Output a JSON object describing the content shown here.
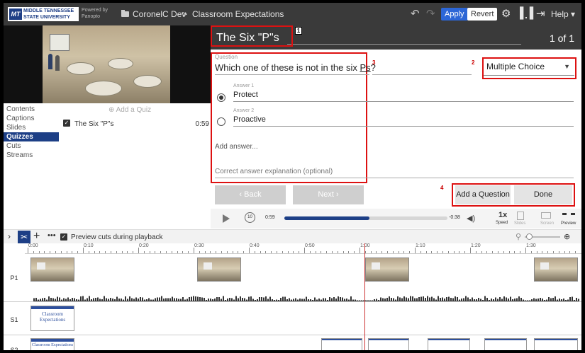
{
  "brand": {
    "line1": "MIDDLE TENNESSEE",
    "line2": "STATE UNIVERSITY",
    "mark": "MT",
    "powered_line1": "Powered by",
    "powered_line2": "Panopto"
  },
  "breadcrumb": {
    "folder": "CoronelC Dev",
    "separator": ">",
    "session": "Classroom Expectations"
  },
  "toolbar": {
    "undo": "↶",
    "redo": "↷",
    "apply": "Apply",
    "revert": "Revert",
    "settings_icon": "⚙",
    "stats_icon": "▐",
    "exit_icon": "⇥",
    "help": "Help ▾"
  },
  "nav": {
    "items": [
      "Contents",
      "Captions",
      "Slides",
      "Quizzes",
      "Cuts",
      "Streams"
    ],
    "active": "Quizzes"
  },
  "quizzes": {
    "add_label": "⊕ Add a Quiz",
    "rows": [
      {
        "title": "The Six \"P\"s",
        "time": "0:59"
      }
    ]
  },
  "quiz_editor": {
    "title": "The Six \"P\"s",
    "page": "1 of 1",
    "question_label": "Question",
    "question_prefix": "Which one of these is not in the six ",
    "question_underlined": "Ps",
    "question_suffix": "?",
    "type": "Multiple Choice",
    "answers": [
      {
        "label": "Answer 1",
        "text": "Protect",
        "selected": true
      },
      {
        "label": "Answer 2",
        "text": "Proactive",
        "selected": false
      }
    ],
    "add_answer": "Add answer...",
    "explanation_placeholder": "Correct answer explanation (optional)",
    "back": "‹  Back",
    "next": "Next  ›",
    "add_question": "Add a Question",
    "done": "Done"
  },
  "callouts": {
    "c1": "1",
    "c2": "2",
    "c3": "3",
    "c4": "4"
  },
  "player": {
    "current": "0:59",
    "remaining": "-0:38",
    "progress": 0.52,
    "rewind": "10",
    "speed": "1x",
    "speed_label": "Speed",
    "slides_label": "Slides",
    "screen_label": "Screen",
    "preview_label": "Preview"
  },
  "timeline": {
    "preview_cuts": "Preview cuts during playback",
    "ticks": [
      "0:00",
      "0:10",
      "0:20",
      "0:30",
      "0:40",
      "0:50",
      "1:00",
      "1:10",
      "1:20",
      "1:30"
    ],
    "tracks": [
      "P1",
      "S1",
      "S2"
    ],
    "slide_title": "Classroom Expectations"
  },
  "colors": {
    "accent": "#1d3f86",
    "apply": "#2c66d6",
    "callout": "#d11111",
    "topbar": "#3a3a3a"
  }
}
